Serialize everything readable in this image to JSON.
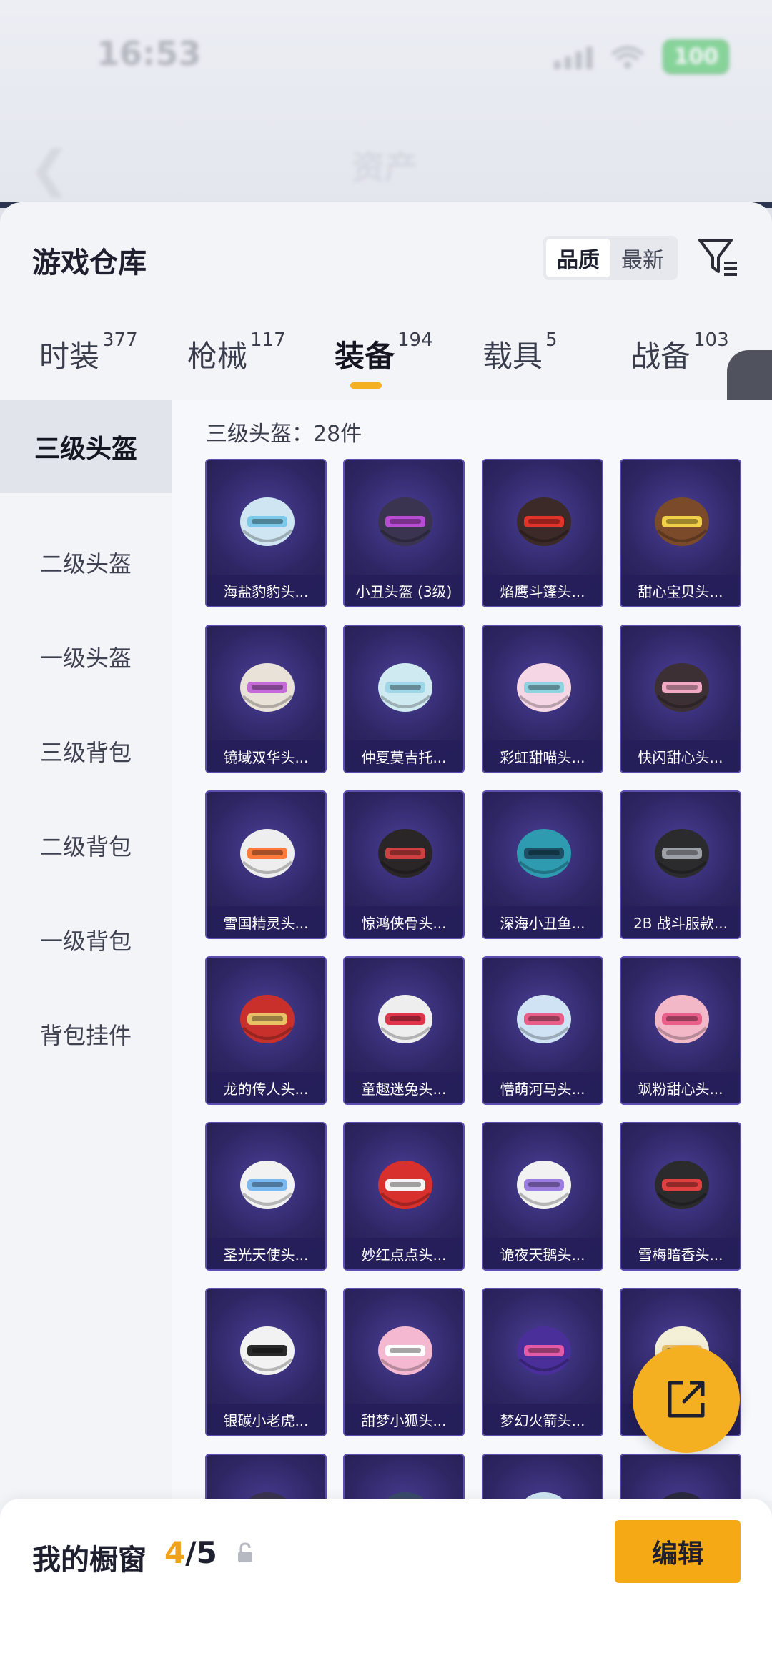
{
  "status_bar": {
    "time": "16:53",
    "battery": "100"
  },
  "header": {
    "title": "资产"
  },
  "panel": {
    "title": "游戏仓库",
    "sort_options": [
      "品质",
      "最新"
    ],
    "active_sort": "品质"
  },
  "tabs": [
    {
      "label": "时装",
      "count": "377"
    },
    {
      "label": "枪械",
      "count": "117"
    },
    {
      "label": "装备",
      "count": "194"
    },
    {
      "label": "载具",
      "count": "5"
    },
    {
      "label": "战备",
      "count": "103"
    }
  ],
  "active_tab": "装备",
  "sidebar": {
    "items": [
      "三级头盔",
      "二级头盔",
      "一级头盔",
      "三级背包",
      "二级背包",
      "一级背包",
      "背包挂件"
    ],
    "active": "三级头盔"
  },
  "grid": {
    "count_label": "三级头盔：28件",
    "items": [
      {
        "name": "海盐豹豹头...",
        "color": "#cfe6f2",
        "accent": "#7bc9e8"
      },
      {
        "name": "小丑头盔 (3级)",
        "color": "#3a3450",
        "accent": "#b94bd6"
      },
      {
        "name": "焰鹰斗篷头...",
        "color": "#3b2a28",
        "accent": "#e0342b"
      },
      {
        "name": "甜心宝贝头...",
        "color": "#7a4a2a",
        "accent": "#f0d046"
      },
      {
        "name": "镜域双华头...",
        "color": "#e8e2d8",
        "accent": "#c36bd8"
      },
      {
        "name": "仲夏莫吉托...",
        "color": "#cfeaf0",
        "accent": "#9fd6e8"
      },
      {
        "name": "彩虹甜喵头...",
        "color": "#f4d6e4",
        "accent": "#8fd3e0"
      },
      {
        "name": "快闪甜心头...",
        "color": "#3c3034",
        "accent": "#f2a9c4"
      },
      {
        "name": "雪国精灵头...",
        "color": "#eeeeee",
        "accent": "#ff7a3a"
      },
      {
        "name": "惊鸿侠骨头...",
        "color": "#2a2628",
        "accent": "#d04040"
      },
      {
        "name": "深海小丑鱼...",
        "color": "#2e9bb0",
        "accent": "#1d4f66"
      },
      {
        "name": "2B 战斗服款...",
        "color": "#2b2b2e",
        "accent": "#9ea0a8"
      },
      {
        "name": "龙的传人头...",
        "color": "#c9302c",
        "accent": "#e8c066"
      },
      {
        "name": "童趣迷兔头...",
        "color": "#eeeeee",
        "accent": "#e0344a"
      },
      {
        "name": "懵萌河马头...",
        "color": "#cfe3f4",
        "accent": "#e85f8a"
      },
      {
        "name": "飒粉甜心头...",
        "color": "#f3b8c8",
        "accent": "#e85f8a"
      },
      {
        "name": "圣光天使头...",
        "color": "#f2f2f2",
        "accent": "#7ab8f0"
      },
      {
        "name": "妙红点点头...",
        "color": "#d8302c",
        "accent": "#f4f4f4"
      },
      {
        "name": "诡夜天鹅头...",
        "color": "#f2f2f2",
        "accent": "#9b7de0"
      },
      {
        "name": "雪梅暗香头...",
        "color": "#2b2b2e",
        "accent": "#e04040"
      },
      {
        "name": "银碳小老虎...",
        "color": "#f2f2f2",
        "accent": "#2a2a2a"
      },
      {
        "name": "甜梦小狐头...",
        "color": "#f4b8d0",
        "accent": "#ffffff"
      },
      {
        "name": "梦幻火箭头...",
        "color": "#4a2f9a",
        "accent": "#e25aa8"
      },
      {
        "name": "",
        "color": "#f4f0d8",
        "accent": "#e8c066"
      },
      {
        "name": "",
        "color": "#3a3450",
        "accent": "#e0a040"
      },
      {
        "name": "",
        "color": "#3a4a6a",
        "accent": "#8fd3e0"
      },
      {
        "name": "",
        "color": "#cfe6f2",
        "accent": "#ffffff"
      },
      {
        "name": "",
        "color": "#2a2a40",
        "accent": "#6a8ae0"
      }
    ]
  },
  "bottom_bar": {
    "label": "我的橱窗",
    "current": "4",
    "total": "/5",
    "edit_label": "编辑"
  },
  "colors": {
    "accent": "#f5b021",
    "card_bg": "#2d2663"
  }
}
